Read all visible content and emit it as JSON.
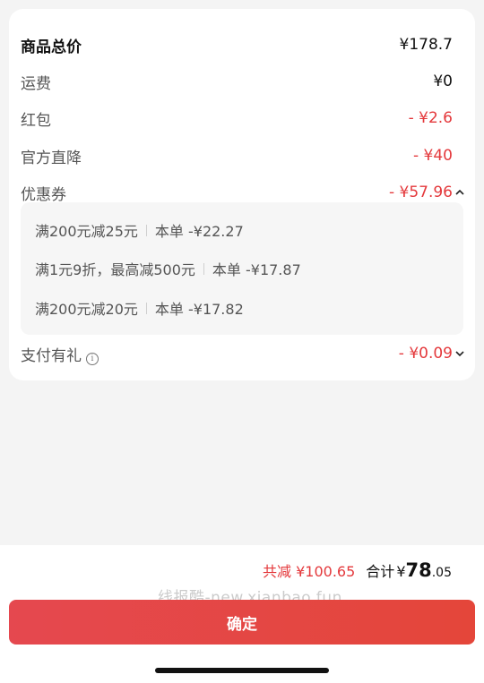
{
  "summary_rows": {
    "goods_total": {
      "label": "商品总价",
      "value": "¥178.7"
    },
    "shipping": {
      "label": "运费",
      "value": "¥0"
    },
    "red_packet": {
      "label": "红包",
      "value": "- ¥2.6"
    },
    "official_discount": {
      "label": "官方直降",
      "value": "- ¥40"
    },
    "coupon": {
      "label": "优惠券",
      "value": "- ¥57.96"
    },
    "payment_gift": {
      "label": "支付有礼",
      "value": "- ¥0.09"
    }
  },
  "coupons": [
    {
      "name": "满200元减25元",
      "amount": "本单 -¥22.27"
    },
    {
      "name": "满1元9折，最高减500元",
      "amount": "本单 -¥17.87"
    },
    {
      "name": "满200元减20元",
      "amount": "本单 -¥17.82"
    }
  ],
  "footer": {
    "saved": "共减 ¥100.65",
    "total_label": "合计",
    "total_currency": "¥",
    "total_int": "78",
    "total_dec": ".05",
    "watermark": "线报酷-new.xianbao.fun",
    "confirm_label": "确定"
  },
  "colors": {
    "accent_red": "#e4393c",
    "button": "#e4463f"
  }
}
